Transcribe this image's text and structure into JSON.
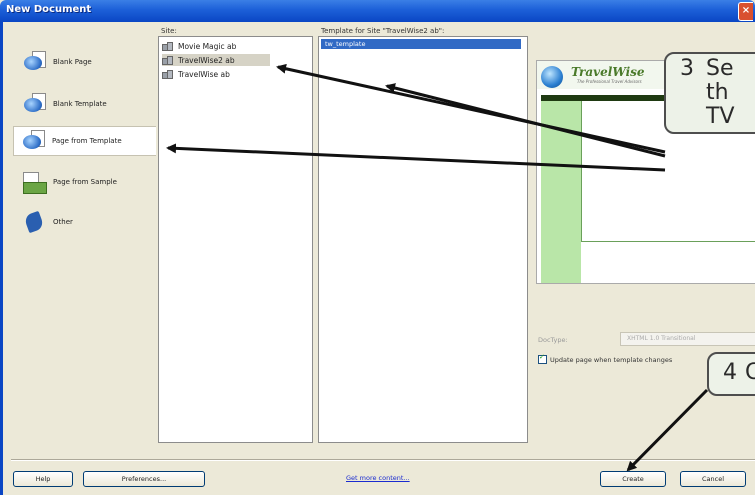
{
  "window": {
    "title": "New Document",
    "close_glyph": "×"
  },
  "nav": {
    "items": [
      {
        "label": "Blank Page",
        "icon": "blank-page-icon"
      },
      {
        "label": "Blank Template",
        "icon": "blank-template-icon"
      },
      {
        "label": "Page from Template",
        "icon": "page-from-template-icon",
        "selected": true
      },
      {
        "label": "Page from Sample",
        "icon": "page-from-sample-icon"
      },
      {
        "label": "Other",
        "icon": "other-icon"
      }
    ]
  },
  "site": {
    "label": "Site:",
    "items": [
      {
        "label": "Movie Magic ab"
      },
      {
        "label": "TravelWise2 ab",
        "selected": true
      },
      {
        "label": "TravelWise ab"
      }
    ]
  },
  "template": {
    "label": "Template for Site \"TravelWise2 ab\":",
    "selected_item": "tw_template"
  },
  "preview": {
    "logo": "TravelWise",
    "tagline": "The Professional Travel Advisors"
  },
  "options": {
    "doctype_label": "DocType:",
    "doctype_value": "XHTML 1.0 Transitional",
    "update_checkbox_label": "Update page when template changes",
    "update_checked": true
  },
  "footer": {
    "help": "Help",
    "preferences": "Preferences...",
    "get_more": "Get more content...",
    "create": "Create",
    "cancel": "Cancel"
  },
  "callouts": {
    "step3_num": "3",
    "step3_lines": [
      "Se",
      "th",
      "TV"
    ],
    "step4_num": "4",
    "step4_text": "Cl"
  }
}
